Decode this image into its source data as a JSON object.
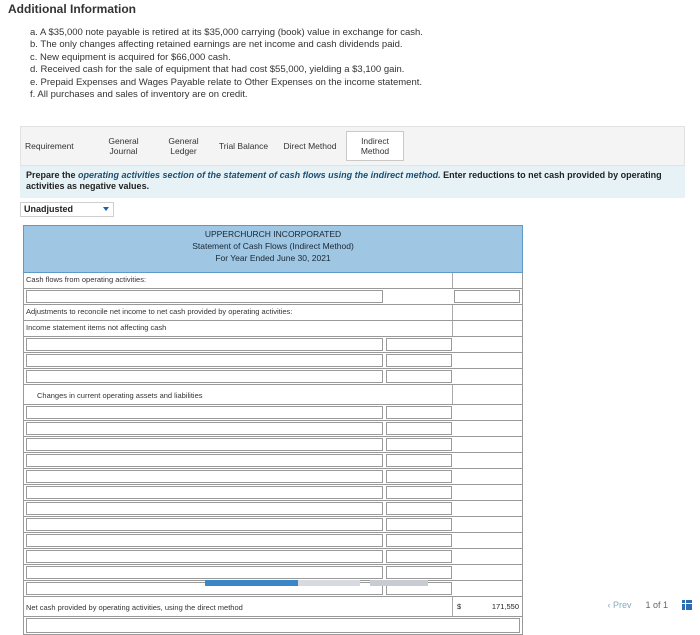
{
  "additional": {
    "title": "Additional Information",
    "items": [
      "a. A $35,000 note payable is retired at its $35,000 carrying (book) value in exchange for cash.",
      "b. The only changes affecting retained earnings are net income and cash dividends paid.",
      "c. New equipment is acquired for $66,000 cash.",
      "d. Received cash for the sale of equipment that had cost $55,000, yielding a $3,100 gain.",
      "e. Prepaid Expenses and Wages Payable relate to Other Expenses on the income statement.",
      "f. All purchases and sales of inventory are on credit."
    ]
  },
  "tabs": {
    "requirement": "Requirement",
    "general_journal": "General Journal",
    "general_ledger": "General Ledger",
    "trial_balance": "Trial Balance",
    "direct_method": "Direct Method",
    "indirect_method": "Indirect Method"
  },
  "instruction": {
    "part1": "Prepare the ",
    "emphasis": "operating activities section of the statement of cash flows using the indirect method.",
    "part2": " Enter reductions to net cash provided by operating activities as negative values."
  },
  "dropdown": {
    "selected": "Unadjusted"
  },
  "statement": {
    "company": "UPPERCHURCH INCORPORATED",
    "title": "Statement of Cash Flows (Indirect Method)",
    "period": "For Year Ended June 30, 2021",
    "section_operating": "Cash flows from operating activities:",
    "adjustments_label": "Adjustments to reconcile net income to net cash provided by operating activities:",
    "noncash_label": "Income statement items not affecting cash",
    "changes_label": "Changes in current operating assets and liabilities",
    "net_cash_label": "Net cash provided by operating activities, using the direct method",
    "currency": "$",
    "net_cash_value": "171,550"
  },
  "pager": {
    "prev": "Prev",
    "page_of": "1 of 1"
  },
  "colors": {
    "accent": "#3a87c8",
    "header_bg": "#9fc6e3",
    "instruction_bg": "#e7f2f6"
  }
}
